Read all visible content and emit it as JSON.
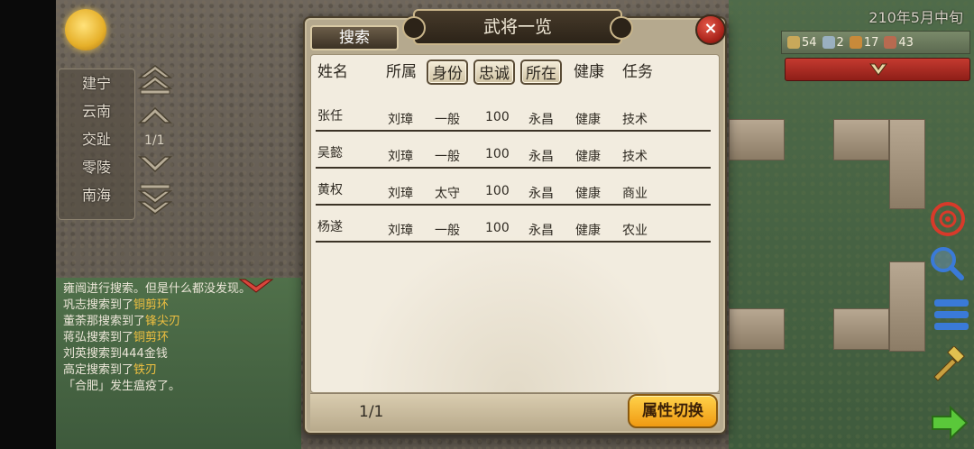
{
  "status": {
    "date": "210年5月中旬"
  },
  "regions": {
    "items": [
      "建宁",
      "云南",
      "交趾",
      "零陵",
      "南海"
    ],
    "page": "1/1"
  },
  "resources": [
    {
      "icon": "troops-icon",
      "value": "54"
    },
    {
      "icon": "officer-icon",
      "value": "2"
    },
    {
      "icon": "horse-icon",
      "value": "17"
    },
    {
      "icon": "soldier-icon",
      "value": "43"
    }
  ],
  "log": [
    {
      "pre": "雍闿进行搜索。但是什么都没发现。",
      "item": "",
      "post": ""
    },
    {
      "pre": "巩志搜索到了",
      "item": "铜剪环",
      "post": ""
    },
    {
      "pre": "董荼那搜索到了",
      "item": "锋尖刃",
      "post": ""
    },
    {
      "pre": "蒋弘搜索到了",
      "item": "铜剪环",
      "post": ""
    },
    {
      "pre": "刘英搜索到444金钱",
      "item": "",
      "post": ""
    },
    {
      "pre": "高定搜索到了",
      "item": "铁刃",
      "post": ""
    },
    {
      "pre": "「合肥」发生瘟疫了。",
      "item": "",
      "post": ""
    }
  ],
  "dialog": {
    "title": "武将一览",
    "search_label": "搜索",
    "close_label": "×",
    "headers": {
      "name": "姓名",
      "affiliation": "所属",
      "status": "身份",
      "loyalty": "忠诚",
      "location": "所在",
      "health": "健康",
      "task": "任务"
    },
    "rows": [
      {
        "name": "张任",
        "affiliation": "刘璋",
        "status": "一般",
        "loyalty": "100",
        "location": "永昌",
        "health": "健康",
        "task": "技术"
      },
      {
        "name": "吴懿",
        "affiliation": "刘璋",
        "status": "一般",
        "loyalty": "100",
        "location": "永昌",
        "health": "健康",
        "task": "技术"
      },
      {
        "name": "黄权",
        "affiliation": "刘璋",
        "status": "太守",
        "loyalty": "100",
        "location": "永昌",
        "health": "健康",
        "task": "商业"
      },
      {
        "name": "杨遂",
        "affiliation": "刘璋",
        "status": "一般",
        "loyalty": "100",
        "location": "永昌",
        "health": "健康",
        "task": "农业"
      }
    ],
    "page": "1/1",
    "switch_label": "属性切换"
  },
  "colors": {
    "accent": "#f0a818",
    "panel": "#f2ecdf",
    "log_highlight": "#f0c040"
  }
}
